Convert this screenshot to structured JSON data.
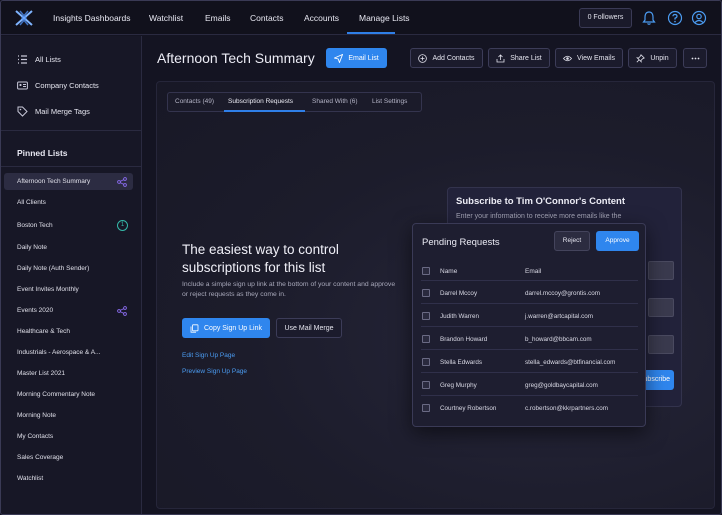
{
  "nav": {
    "items": [
      "Insights Dashboards",
      "Watchlist",
      "Emails",
      "Contacts",
      "Accounts",
      "Manage Lists"
    ],
    "followers_label": "0 Followers"
  },
  "sidebar": {
    "main_items": [
      {
        "label": "All Lists",
        "icon": "list-icon"
      },
      {
        "label": "Company Contacts",
        "icon": "contact-card-icon"
      },
      {
        "label": "Mail Merge Tags",
        "icon": "tag-icon"
      }
    ],
    "pinned_title": "Pinned Lists",
    "pinned_items": [
      "Afternoon Tech Summary",
      "All Clients",
      "Boston Tech",
      "Daily Note",
      "Daily Note (Auth Sender)",
      "Event Invites Monthly",
      "Events 2020",
      "Healthcare & Tech",
      "Industrials - Aerospace & A...",
      "Master List 2021",
      "Morning Commentary Note",
      "Morning Note",
      "My Contacts",
      "Sales Coverage",
      "Watchlist"
    ],
    "boston_badge": "1"
  },
  "header": {
    "title": "Afternoon Tech Summary",
    "email_list": "Email List",
    "add_contacts": "Add Contacts",
    "share_list": "Share List",
    "view_emails": "View Emails",
    "unpin": "Unpin"
  },
  "tabs": [
    "Contacts (49)",
    "Subscription Requests",
    "Shared With (6)",
    "List Settings"
  ],
  "hero": {
    "title": "The easiest way to control subscriptions for this list",
    "description": "Include a simple sign up link at the bottom of your content and approve or reject requests as they come in.",
    "copy_link": "Copy Sign Up Link",
    "use_mail_merge": "Use Mail Merge",
    "edit_link": "Edit Sign Up Page",
    "preview_link": "Preview Sign Up Page"
  },
  "subscribe_preview": {
    "title": "Subscribe to Tim O'Connor's Content",
    "subtitle": "Enter your information to receive more emails like the",
    "button": "Subscribe"
  },
  "pending": {
    "title": "Pending Requests",
    "reject": "Reject",
    "approve": "Approve",
    "col_name": "Name",
    "col_email": "Email",
    "rows": [
      {
        "name": "Darrel Mccoy",
        "email": "darrel.mccoy@grontis.com"
      },
      {
        "name": "Judith Warren",
        "email": "j.warren@artcapital.com"
      },
      {
        "name": "Brandon Howard",
        "email": "b_howard@bbcam.com"
      },
      {
        "name": "Stella Edwards",
        "email": "stella_edwards@btfinancial.com"
      },
      {
        "name": "Greg Murphy",
        "email": "greg@goldbaycapital.com"
      },
      {
        "name": "Courtney Robertson",
        "email": "c.robertson@kkrpartners.com"
      }
    ]
  },
  "colors": {
    "accent": "#2f86ee",
    "link": "#4b9cf2",
    "badge": "#35b8a8",
    "share": "#8a6cf0"
  }
}
